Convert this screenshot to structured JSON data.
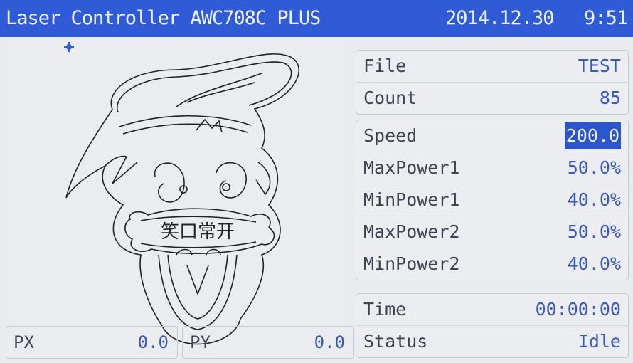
{
  "titlebar": {
    "title": "Laser Controller AWC708C PLUS",
    "date": "2014.12.30",
    "time": "9:51",
    "color": "#2f5bd6"
  },
  "preview": {
    "caption_text": "笑口常开",
    "origin_marker_icon": "crosshair-icon"
  },
  "position": {
    "px_label": "PX",
    "px_value": "0.0",
    "py_label": "PY",
    "py_value": "0.0"
  },
  "job": {
    "file_label": "File",
    "file_value": "TEST",
    "count_label": "Count",
    "count_value": "85"
  },
  "params": {
    "speed_label": "Speed",
    "speed_value": "200.0",
    "maxpower1_label": "MaxPower1",
    "maxpower1_value": "50.0%",
    "minpower1_label": "MinPower1",
    "minpower1_value": "40.0%",
    "maxpower2_label": "MaxPower2",
    "maxpower2_value": "50.0%",
    "minpower2_label": "MinPower2",
    "minpower2_value": "40.0%"
  },
  "status": {
    "time_label": "Time",
    "time_value": "00:00:00",
    "status_label": "Status",
    "status_value": "Idle"
  },
  "colors": {
    "accent": "#2f5bd6",
    "value_text": "#3a58bd",
    "label_text": "#3d4352"
  }
}
